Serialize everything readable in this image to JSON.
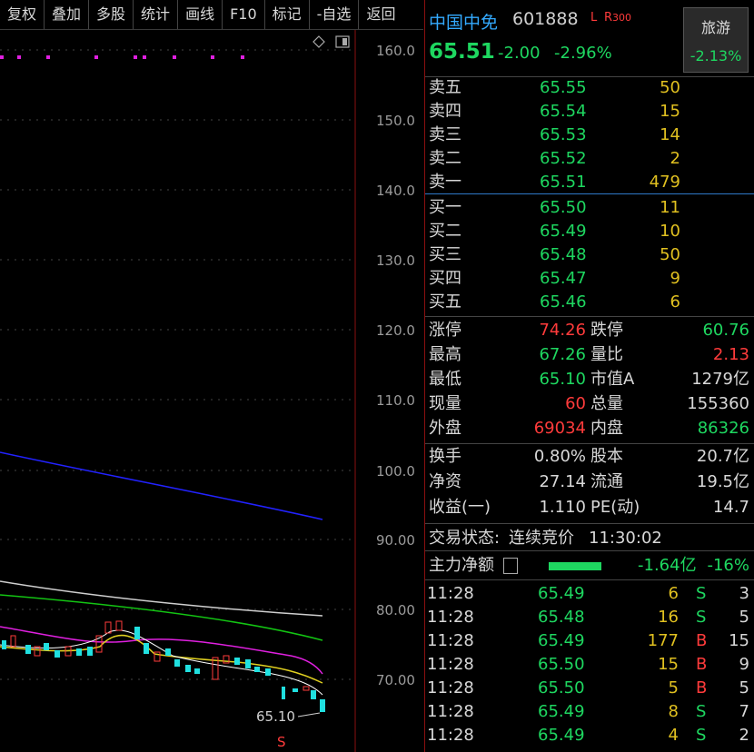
{
  "toolbar": [
    "复权",
    "叠加",
    "多股",
    "统计",
    "画线",
    "F10",
    "标记",
    "-自选",
    "返回"
  ],
  "chart": {
    "y_ticks": [
      "160.0",
      "150.0",
      "140.0",
      "130.0",
      "120.0",
      "110.0",
      "100.0",
      "90.00",
      "80.00",
      "70.00"
    ],
    "low_label": "65.10",
    "sell_marker": "S",
    "colors": {
      "ma_blue": "#2222ff",
      "ma_white": "#cfcfcf",
      "ma_green": "#13c413",
      "ma_magenta": "#e020e0",
      "ma_yellow": "#e0d020",
      "candle_up": "#ff3b3b",
      "candle_down": "#20e0e0"
    }
  },
  "quote": {
    "name": "中国中免",
    "code": "601888",
    "flag_l": "L",
    "flag_r": "R",
    "flag_num": "300",
    "price": "65.51",
    "change": "-2.00",
    "change_pct": "-2.96%",
    "sector_name": "旅游",
    "sector_pct": "-2.13%"
  },
  "asks": [
    {
      "label": "卖五",
      "price": "65.55",
      "vol": "50"
    },
    {
      "label": "卖四",
      "price": "65.54",
      "vol": "15"
    },
    {
      "label": "卖三",
      "price": "65.53",
      "vol": "14"
    },
    {
      "label": "卖二",
      "price": "65.52",
      "vol": "2"
    },
    {
      "label": "卖一",
      "price": "65.51",
      "vol": "479"
    }
  ],
  "bids": [
    {
      "label": "买一",
      "price": "65.50",
      "vol": "11"
    },
    {
      "label": "买二",
      "price": "65.49",
      "vol": "10"
    },
    {
      "label": "买三",
      "price": "65.48",
      "vol": "50"
    },
    {
      "label": "买四",
      "price": "65.47",
      "vol": "9"
    },
    {
      "label": "买五",
      "price": "65.46",
      "vol": "6"
    }
  ],
  "stats": [
    {
      "l1": "涨停",
      "v1": "74.26",
      "c1": "r",
      "l2": "跌停",
      "v2": "60.76",
      "c2": "g"
    },
    {
      "l1": "最高",
      "v1": "67.26",
      "c1": "g",
      "l2": "量比",
      "v2": "2.13",
      "c2": "r"
    },
    {
      "l1": "最低",
      "v1": "65.10",
      "c1": "g",
      "l2": "市值A",
      "v2": "1279亿",
      "c2": "w"
    },
    {
      "l1": "现量",
      "v1": "60",
      "c1": "r",
      "l2": "总量",
      "v2": "155360",
      "c2": "w"
    },
    {
      "l1": "外盘",
      "v1": "69034",
      "c1": "r",
      "l2": "内盘",
      "v2": "86326",
      "c2": "g"
    }
  ],
  "stats2": [
    {
      "l1": "换手",
      "v1": "0.80%",
      "l2": "股本",
      "v2": "20.7亿"
    },
    {
      "l1": "净资",
      "v1": "27.14",
      "l2": "流通",
      "v2": "19.5亿"
    },
    {
      "l1": "收益(一)",
      "v1": "1.110",
      "l2": "PE(动)",
      "v2": "14.7"
    }
  ],
  "status": {
    "label": "交易状态:",
    "state": "连续竞价",
    "time": "11:30:02"
  },
  "flow": {
    "label": "主力净额",
    "value": "-1.64亿",
    "pct": "-16%"
  },
  "ticks": [
    {
      "time": "11:28",
      "price": "65.49",
      "vol": "6",
      "side": "S",
      "n": "3"
    },
    {
      "time": "11:28",
      "price": "65.48",
      "vol": "16",
      "side": "S",
      "n": "5"
    },
    {
      "time": "11:28",
      "price": "65.49",
      "vol": "177",
      "side": "B",
      "n": "15"
    },
    {
      "time": "11:28",
      "price": "65.50",
      "vol": "15",
      "side": "B",
      "n": "9"
    },
    {
      "time": "11:28",
      "price": "65.50",
      "vol": "5",
      "side": "B",
      "n": "5"
    },
    {
      "time": "11:28",
      "price": "65.49",
      "vol": "8",
      "side": "S",
      "n": "7"
    },
    {
      "time": "11:28",
      "price": "65.49",
      "vol": "4",
      "side": "S",
      "n": "2"
    }
  ]
}
